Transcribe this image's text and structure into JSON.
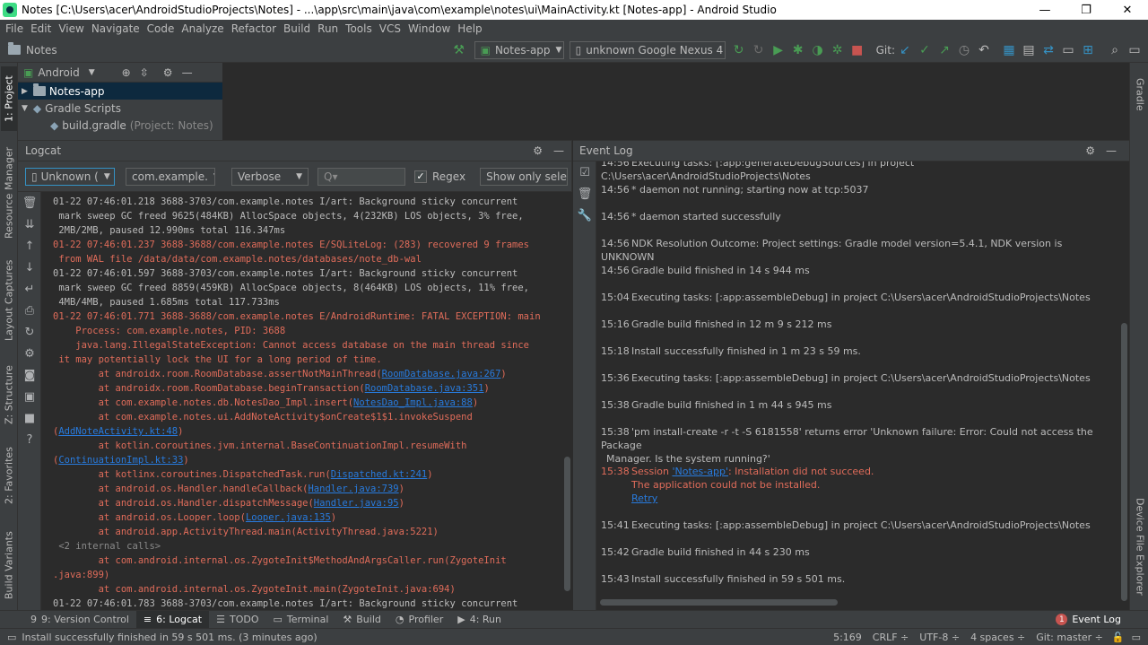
{
  "window": {
    "title": "Notes [C:\\Users\\acer\\AndroidStudioProjects\\Notes] - ...\\app\\src\\main\\java\\com\\example\\notes\\ui\\MainActivity.kt [Notes-app] - Android Studio",
    "minimize": "—",
    "maximize": "❐",
    "close": "✕"
  },
  "menu": [
    "File",
    "Edit",
    "View",
    "Navigate",
    "Code",
    "Analyze",
    "Refactor",
    "Build",
    "Run",
    "Tools",
    "VCS",
    "Window",
    "Help"
  ],
  "nav": {
    "project": "Notes",
    "run_config": "Notes-app",
    "device": "unknown Google Nexus 4",
    "git_label": "Git:"
  },
  "left_tabs": {
    "project": "1: Project",
    "resource_manager": "Resource Manager",
    "layout_captures": "Layout Captures",
    "structure": "Z: Structure",
    "favorites": "2: Favorites",
    "build_variants": "Build Variants"
  },
  "right_tabs": {
    "gradle": "Gradle",
    "device_explorer": "Device File Explorer"
  },
  "project_panel": {
    "view_mode": "Android",
    "items": [
      {
        "label": "Notes-app",
        "hint": ""
      },
      {
        "label": "Gradle Scripts",
        "hint": ""
      },
      {
        "label": "build.gradle",
        "hint": "(Project: Notes)"
      }
    ]
  },
  "logcat": {
    "title": "Logcat",
    "device_filter": "Unknown (",
    "package_filter": "com.example.",
    "level": "Verbose",
    "search_placeholder": "Q▾",
    "regex_label": "Regex",
    "show_only": "Show only sele",
    "lines": [
      {
        "t": "01-22 07:46:01.218 3688-3703/com.example.notes I/art: Background sticky concurrent",
        "c": ""
      },
      {
        "t": " mark sweep GC freed 9625(484KB) AllocSpace objects, 4(232KB) LOS objects, 3% free,",
        "c": ""
      },
      {
        "t": " 2MB/2MB, paused 12.990ms total 116.347ms",
        "c": ""
      },
      {
        "t": "01-22 07:46:01.237 3688-3688/com.example.notes E/SQLiteLog: (283) recovered 9 frames",
        "c": "err"
      },
      {
        "t": " from WAL file /data/data/com.example.notes/databases/note_db-wal",
        "c": "err"
      },
      {
        "t": "01-22 07:46:01.597 3688-3703/com.example.notes I/art: Background sticky concurrent",
        "c": ""
      },
      {
        "t": " mark sweep GC freed 8859(459KB) AllocSpace objects, 8(464KB) LOS objects, 11% free,",
        "c": ""
      },
      {
        "t": " 4MB/4MB, paused 1.685ms total 117.733ms",
        "c": ""
      },
      {
        "t": "01-22 07:46:01.771 3688-3688/com.example.notes E/AndroidRuntime: FATAL EXCEPTION: main",
        "c": "err"
      },
      {
        "t": "    Process: com.example.notes, PID: 3688",
        "c": "err"
      },
      {
        "t": "    java.lang.IllegalStateException: Cannot access database on the main thread since",
        "c": "err"
      },
      {
        "t": " it may potentially lock the UI for a long period of time.",
        "c": "err"
      },
      {
        "t": "        at androidx.room.RoomDatabase.assertNotMainThread(",
        "c": "err",
        "link": "RoomDatabase.java:267",
        "after": ")"
      },
      {
        "t": "        at androidx.room.RoomDatabase.beginTransaction(",
        "c": "err",
        "link": "RoomDatabase.java:351",
        "after": ")"
      },
      {
        "t": "        at com.example.notes.db.NotesDao_Impl.insert(",
        "c": "err",
        "link": "NotesDao_Impl.java:88",
        "after": ")"
      },
      {
        "t": "        at com.example.notes.ui.AddNoteActivity$onCreate$1$1.invokeSuspend",
        "c": "err"
      },
      {
        "t": "(",
        "c": "err",
        "link": "AddNoteActivity.kt:48",
        "after": ")"
      },
      {
        "t": "        at kotlin.coroutines.jvm.internal.BaseContinuationImpl.resumeWith",
        "c": "err"
      },
      {
        "t": "(",
        "c": "err",
        "link": "ContinuationImpl.kt:33",
        "after": ")"
      },
      {
        "t": "        at kotlinx.coroutines.DispatchedTask.run(",
        "c": "err",
        "link": "Dispatched.kt:241",
        "after": ")"
      },
      {
        "t": "        at android.os.Handler.handleCallback(",
        "c": "err",
        "link": "Handler.java:739",
        "after": ")"
      },
      {
        "t": "        at android.os.Handler.dispatchMessage(",
        "c": "err",
        "link": "Handler.java:95",
        "after": ")"
      },
      {
        "t": "        at android.os.Looper.loop(",
        "c": "err",
        "link": "Looper.java:135",
        "after": ")"
      },
      {
        "t": "        at android.app.ActivityThread.main(ActivityThread.java:5221)",
        "c": "err"
      },
      {
        "t": " <2 internal calls>",
        "c": "dim"
      },
      {
        "t": "        at com.android.internal.os.ZygoteInit$MethodAndArgsCaller.run(ZygoteInit",
        "c": "err"
      },
      {
        "t": ".java:899)",
        "c": "err"
      },
      {
        "t": "        at com.android.internal.os.ZygoteInit.main(ZygoteInit.java:694)",
        "c": "err"
      },
      {
        "t": "01-22 07:46:01.783 3688-3703/com.example.notes I/art: Background sticky concurrent",
        "c": ""
      }
    ]
  },
  "event_log": {
    "title": "Event Log",
    "entries": [
      {
        "time": "14:56",
        "text": "Executing tasks: [:app:generateDebugSources] in project C:\\Users\\acer\\AndroidStudioProjects\\Notes",
        "cls": ""
      },
      {
        "time": "14:56",
        "text": "* daemon not running; starting now at tcp:5037",
        "cls": ""
      },
      {
        "time": "14:56",
        "text": "* daemon started successfully",
        "cls": ""
      },
      {
        "time": "14:56",
        "text": "NDK Resolution Outcome: Project settings: Gradle model version=5.4.1, NDK version is UNKNOWN",
        "cls": ""
      },
      {
        "time": "14:56",
        "text": "Gradle build finished in 14 s 944 ms",
        "cls": ""
      },
      {
        "time": "15:04",
        "text": "Executing tasks: [:app:assembleDebug] in project C:\\Users\\acer\\AndroidStudioProjects\\Notes",
        "cls": ""
      },
      {
        "time": "15:16",
        "text": "Gradle build finished in 12 m 9 s 212 ms",
        "cls": ""
      },
      {
        "time": "15:18",
        "text": "Install successfully finished in 1 m 23 s 59 ms.",
        "cls": ""
      },
      {
        "time": "15:36",
        "text": "Executing tasks: [:app:assembleDebug] in project C:\\Users\\acer\\AndroidStudioProjects\\Notes",
        "cls": ""
      },
      {
        "time": "15:38",
        "text": "Gradle build finished in 1 m 44 s 945 ms",
        "cls": ""
      },
      {
        "time": "15:38",
        "text": "'pm install-create -r -t -S 6181558' returns error 'Unknown failure: Error: Could not access the Package",
        "cls": ""
      },
      {
        "time": "15:41",
        "text": "Executing tasks: [:app:assembleDebug] in project C:\\Users\\acer\\AndroidStudioProjects\\Notes",
        "cls": ""
      },
      {
        "time": "15:42",
        "text": "Gradle build finished in 44 s 230 ms",
        "cls": ""
      },
      {
        "time": "15:43",
        "text": "Install successfully finished in 59 s 501 ms.",
        "cls": ""
      }
    ],
    "pm_error_cont": "Manager.  Is the system running?'",
    "session_time": "15:38",
    "session_prefix": "Session ",
    "session_link": "'Notes-app'",
    "session_suffix": ": Installation did not succeed.",
    "session_line2": "The application could not be installed.",
    "retry": "Retry"
  },
  "bottom_tabs": [
    {
      "icon": "9",
      "label": "9: Version Control"
    },
    {
      "icon": "≡",
      "label": "6: Logcat"
    },
    {
      "icon": "☰",
      "label": "TODO"
    },
    {
      "icon": "▭",
      "label": "Terminal"
    },
    {
      "icon": "⚒",
      "label": "Build"
    },
    {
      "icon": "◔",
      "label": "Profiler"
    },
    {
      "icon": "▶",
      "label": "4: Run"
    }
  ],
  "event_log_tab": {
    "badge": "1",
    "label": "Event Log"
  },
  "status": {
    "message": "Install successfully finished in 59 s 501 ms. (3 minutes ago)",
    "position": "5:169",
    "line_sep": "CRLF ÷",
    "encoding": "UTF-8 ÷",
    "indent": "4 spaces ÷",
    "git": "Git: master ÷"
  }
}
